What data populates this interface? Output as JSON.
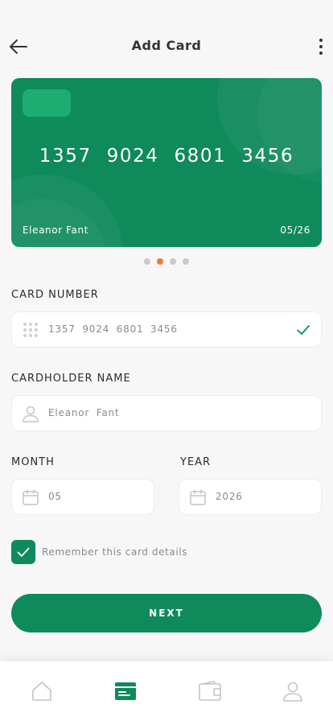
{
  "header": {
    "title": "Add Card"
  },
  "card": {
    "number": "1357 9024 6801 3456",
    "holder": "Eleanor Fant",
    "expiry": "05/26"
  },
  "pagination": {
    "total": 4,
    "active_index": 1
  },
  "form": {
    "card_number_label": "CARD NUMBER",
    "card_number_value": "1357 9024 6801 3456",
    "cardholder_label": "CARDHOLDER NAME",
    "cardholder_value": "Eleanor Fant",
    "month_label": "MONTH",
    "month_value": "05",
    "year_label": "YEAR",
    "year_value": "2026",
    "remember_label": "Remember this card details",
    "remember_checked": true
  },
  "next_button_label": "NEXT",
  "tabbar": {
    "items": [
      {
        "icon": "home-icon",
        "active": false
      },
      {
        "icon": "card-icon",
        "active": true
      },
      {
        "icon": "wallet-icon",
        "active": false
      },
      {
        "icon": "user-icon",
        "active": false
      }
    ]
  },
  "colors": {
    "accent": "#0e8a5b",
    "active_dot": "#ee7a3b",
    "inactive_icon": "#c4c4c4"
  }
}
